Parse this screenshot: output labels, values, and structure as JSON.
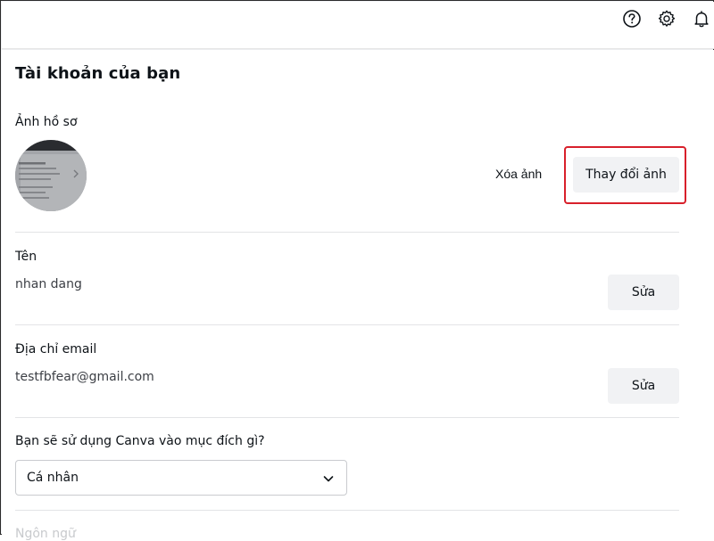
{
  "header": {
    "icons": [
      "help-icon",
      "gear-icon",
      "bell-icon"
    ]
  },
  "page": {
    "title": "Tài khoản của bạn"
  },
  "profile_photo": {
    "label": "Ảnh hồ sơ",
    "remove_label": "Xóa ảnh",
    "change_label": "Thay đổi ảnh",
    "highlight_color": "#d8202b"
  },
  "name": {
    "label": "Tên",
    "value": "nhan dang",
    "edit_label": "Sửa"
  },
  "email": {
    "label": "Địa chỉ email",
    "value": "testfbfear@gmail.com",
    "edit_label": "Sửa"
  },
  "purpose": {
    "label": "Bạn sẽ sử dụng Canva vào mục đích gì?",
    "selected": "Cá nhân"
  },
  "next_section": {
    "label": "Ngôn ngữ"
  }
}
